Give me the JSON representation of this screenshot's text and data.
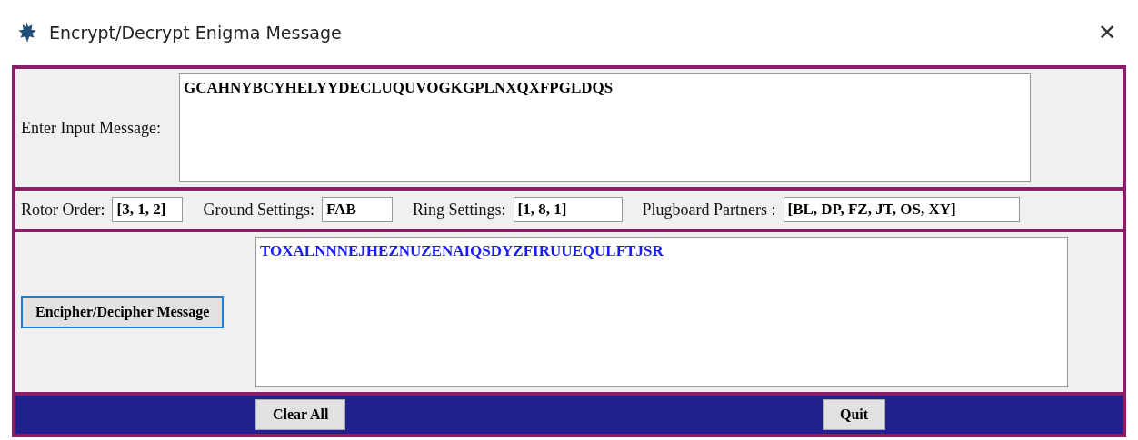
{
  "window": {
    "title": "Encrypt/Decrypt Enigma Message",
    "close": "✕"
  },
  "input": {
    "label": "Enter Input Message:",
    "value": "GCAHNYBCYHELYYDECLUQUVOGKGPLNXQXFPGLDQS"
  },
  "settings": [
    {
      "label": "Rotor Order:",
      "value": "[3, 1, 2]"
    },
    {
      "label": "Ground Settings:",
      "value": "FAB"
    },
    {
      "label": "Ring Settings:",
      "value": "[1, 8, 1]"
    },
    {
      "label": "Plugboard Partners :",
      "value": "[BL, DP, FZ, JT, OS, XY]"
    }
  ],
  "encipher_button": {
    "label": "Encipher/Decipher Message",
    "focused": true
  },
  "output": {
    "value": "TOXALNNNEJHEZNUZENAIQSDYZFIRUUEQULFTJSR"
  },
  "buttons": [
    "Clear All",
    "Quit"
  ]
}
